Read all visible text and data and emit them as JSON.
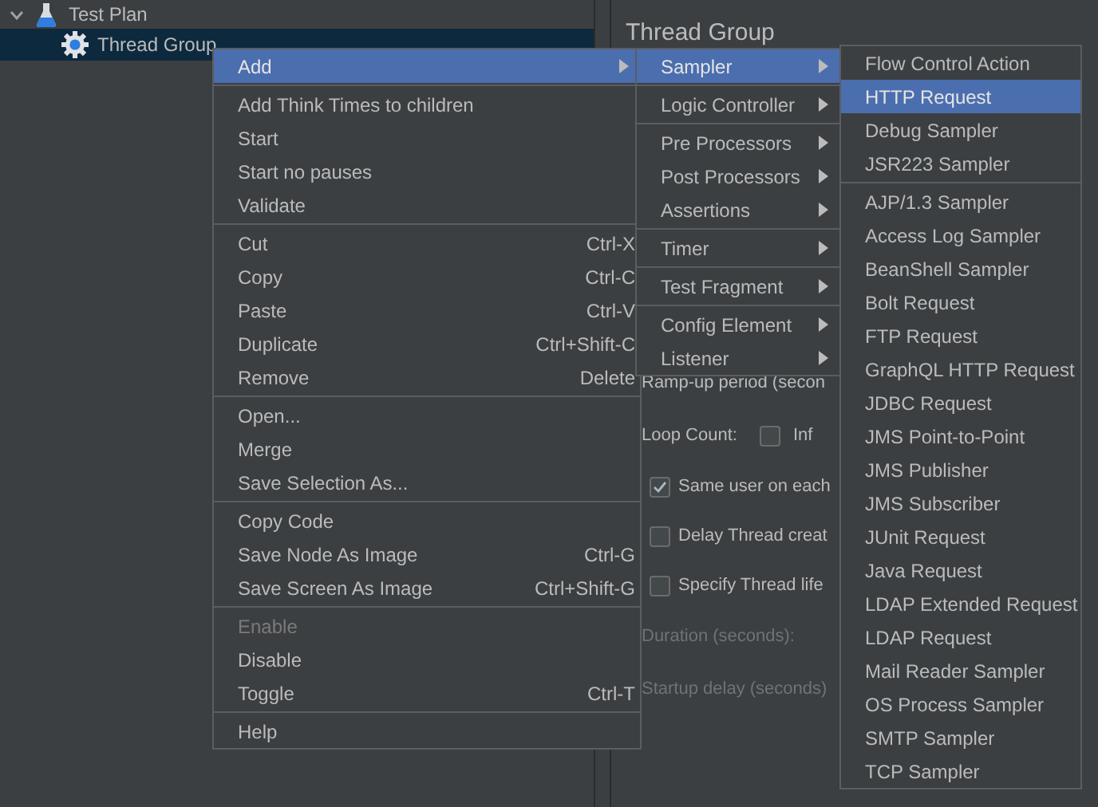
{
  "tree": [
    {
      "label": "Test Plan",
      "expanded": true,
      "selected": false,
      "children": [
        {
          "label": "Thread Group",
          "selected": true
        }
      ]
    }
  ],
  "panel": {
    "title": "Thread Group",
    "rows": [
      {
        "kind": "label",
        "label": "Ramp-up period (secon",
        "disabled": false
      },
      {
        "kind": "loop",
        "label": "Loop Count:",
        "box_label": "Inf",
        "checked": false
      },
      {
        "kind": "checkbox",
        "label": "Same user on each",
        "checked": true
      },
      {
        "kind": "checkbox",
        "label": "Delay Thread creat",
        "checked": false
      },
      {
        "kind": "checkbox",
        "label": "Specify Thread life",
        "checked": false
      },
      {
        "kind": "label",
        "label": "Duration (seconds):",
        "disabled": true
      },
      {
        "kind": "label",
        "label": "Startup delay (seconds)",
        "disabled": true
      }
    ]
  },
  "context_menu": {
    "groups": [
      [
        {
          "label": "Add",
          "selected": true,
          "submenu": true,
          "disabled": false
        }
      ],
      [
        {
          "label": "Add Think Times to children",
          "selected": false,
          "submenu": false,
          "disabled": false
        },
        {
          "label": "Start",
          "selected": false,
          "submenu": false,
          "disabled": false
        },
        {
          "label": "Start no pauses",
          "selected": false,
          "submenu": false,
          "disabled": false
        },
        {
          "label": "Validate",
          "selected": false,
          "submenu": false,
          "disabled": false
        }
      ],
      [
        {
          "label": "Cut",
          "shortcut": "Ctrl-X",
          "selected": false,
          "submenu": false,
          "disabled": false
        },
        {
          "label": "Copy",
          "shortcut": "Ctrl-C",
          "selected": false,
          "submenu": false,
          "disabled": false
        },
        {
          "label": "Paste",
          "shortcut": "Ctrl-V",
          "selected": false,
          "submenu": false,
          "disabled": false
        },
        {
          "label": "Duplicate",
          "shortcut": "Ctrl+Shift-C",
          "selected": false,
          "submenu": false,
          "disabled": false
        },
        {
          "label": "Remove",
          "shortcut": "Delete",
          "selected": false,
          "submenu": false,
          "disabled": false
        }
      ],
      [
        {
          "label": "Open...",
          "selected": false,
          "submenu": false,
          "disabled": false
        },
        {
          "label": "Merge",
          "selected": false,
          "submenu": false,
          "disabled": false
        },
        {
          "label": "Save Selection As...",
          "selected": false,
          "submenu": false,
          "disabled": false
        }
      ],
      [
        {
          "label": "Copy Code",
          "selected": false,
          "submenu": false,
          "disabled": false
        },
        {
          "label": "Save Node As Image",
          "shortcut": "Ctrl-G",
          "selected": false,
          "submenu": false,
          "disabled": false
        },
        {
          "label": "Save Screen As Image",
          "shortcut": "Ctrl+Shift-G",
          "selected": false,
          "submenu": false,
          "disabled": false
        }
      ],
      [
        {
          "label": "Enable",
          "selected": false,
          "submenu": false,
          "disabled": true
        },
        {
          "label": "Disable",
          "selected": false,
          "submenu": false,
          "disabled": false
        },
        {
          "label": "Toggle",
          "shortcut": "Ctrl-T",
          "selected": false,
          "submenu": false,
          "disabled": false
        }
      ],
      [
        {
          "label": "Help",
          "selected": false,
          "submenu": false,
          "disabled": false
        }
      ]
    ]
  },
  "add_menu": {
    "groups": [
      [
        {
          "label": "Sampler",
          "selected": true,
          "submenu": true,
          "disabled": false
        }
      ],
      [
        {
          "label": "Logic Controller",
          "selected": false,
          "submenu": true,
          "disabled": false
        }
      ],
      [
        {
          "label": "Pre Processors",
          "selected": false,
          "submenu": true,
          "disabled": false
        },
        {
          "label": "Post Processors",
          "selected": false,
          "submenu": true,
          "disabled": false
        },
        {
          "label": "Assertions",
          "selected": false,
          "submenu": true,
          "disabled": false
        }
      ],
      [
        {
          "label": "Timer",
          "selected": false,
          "submenu": true,
          "disabled": false
        }
      ],
      [
        {
          "label": "Test Fragment",
          "selected": false,
          "submenu": true,
          "disabled": false
        }
      ],
      [
        {
          "label": "Config Element",
          "selected": false,
          "submenu": true,
          "disabled": false
        },
        {
          "label": "Listener",
          "selected": false,
          "submenu": true,
          "disabled": false
        }
      ]
    ]
  },
  "sampler_menu": {
    "groups": [
      [
        {
          "label": "Flow Control Action",
          "selected": false,
          "submenu": false,
          "disabled": false
        },
        {
          "label": "HTTP Request",
          "selected": true,
          "submenu": false,
          "disabled": false
        },
        {
          "label": "Debug Sampler",
          "selected": false,
          "submenu": false,
          "disabled": false
        },
        {
          "label": "JSR223 Sampler",
          "selected": false,
          "submenu": false,
          "disabled": false
        }
      ],
      [
        {
          "label": "AJP/1.3 Sampler",
          "selected": false,
          "submenu": false,
          "disabled": false
        },
        {
          "label": "Access Log Sampler",
          "selected": false,
          "submenu": false,
          "disabled": false
        },
        {
          "label": "BeanShell Sampler",
          "selected": false,
          "submenu": false,
          "disabled": false
        },
        {
          "label": "Bolt Request",
          "selected": false,
          "submenu": false,
          "disabled": false
        },
        {
          "label": "FTP Request",
          "selected": false,
          "submenu": false,
          "disabled": false
        },
        {
          "label": "GraphQL HTTP Request",
          "selected": false,
          "submenu": false,
          "disabled": false
        },
        {
          "label": "JDBC Request",
          "selected": false,
          "submenu": false,
          "disabled": false
        },
        {
          "label": "JMS Point-to-Point",
          "selected": false,
          "submenu": false,
          "disabled": false
        },
        {
          "label": "JMS Publisher",
          "selected": false,
          "submenu": false,
          "disabled": false
        },
        {
          "label": "JMS Subscriber",
          "selected": false,
          "submenu": false,
          "disabled": false
        },
        {
          "label": "JUnit Request",
          "selected": false,
          "submenu": false,
          "disabled": false
        },
        {
          "label": "Java Request",
          "selected": false,
          "submenu": false,
          "disabled": false
        },
        {
          "label": "LDAP Extended Request",
          "selected": false,
          "submenu": false,
          "disabled": false
        },
        {
          "label": "LDAP Request",
          "selected": false,
          "submenu": false,
          "disabled": false
        },
        {
          "label": "Mail Reader Sampler",
          "selected": false,
          "submenu": false,
          "disabled": false
        },
        {
          "label": "OS Process Sampler",
          "selected": false,
          "submenu": false,
          "disabled": false
        },
        {
          "label": "SMTP Sampler",
          "selected": false,
          "submenu": false,
          "disabled": false
        },
        {
          "label": "TCP Sampler",
          "selected": false,
          "submenu": false,
          "disabled": false
        }
      ]
    ]
  }
}
